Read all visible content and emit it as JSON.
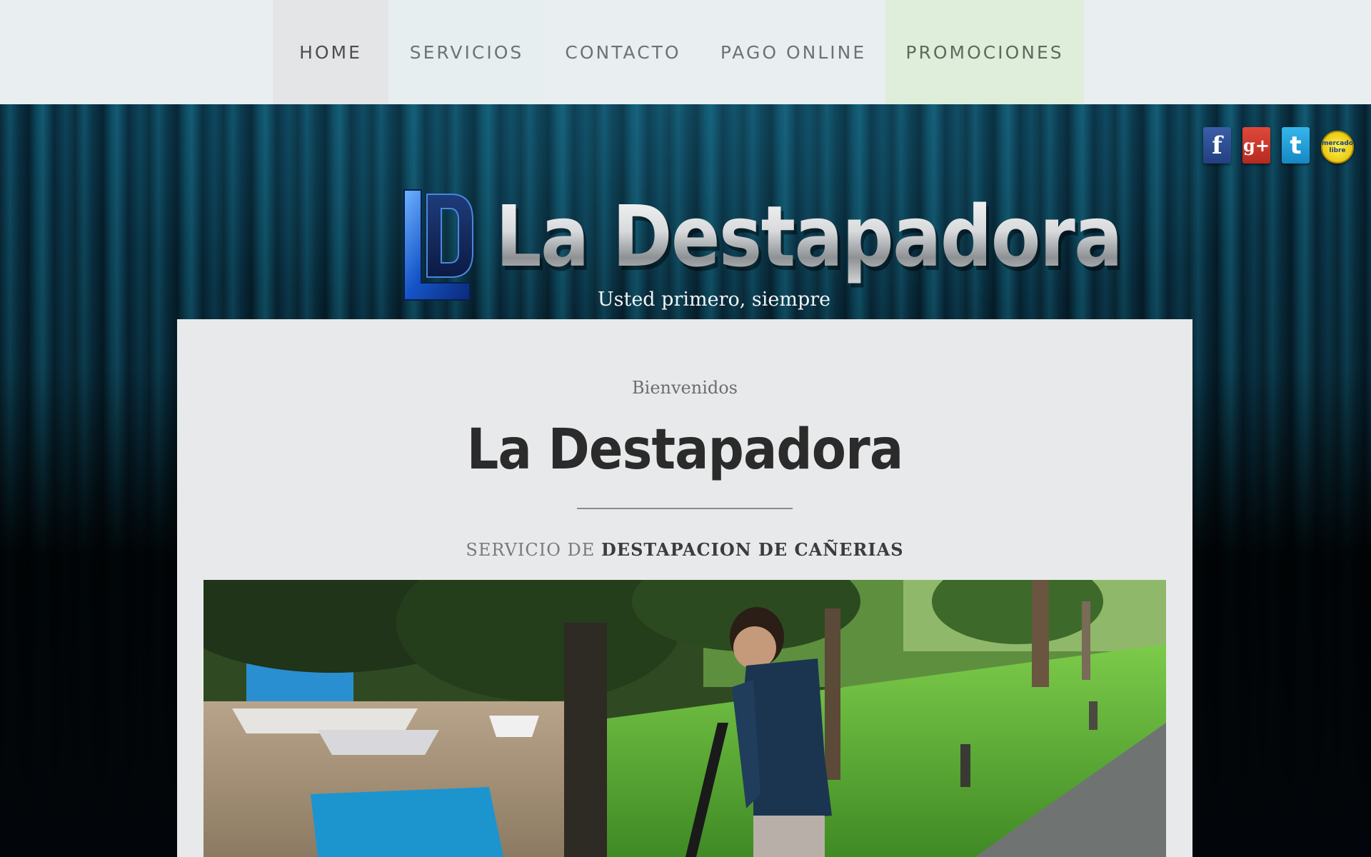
{
  "nav": {
    "items": [
      {
        "label": "HOME"
      },
      {
        "label": "SERVICIOS"
      },
      {
        "label": "CONTACTO"
      },
      {
        "label": "PAGO ONLINE"
      },
      {
        "label": "PROMOCIONES"
      }
    ]
  },
  "social": {
    "facebook_glyph": "f",
    "googleplus_glyph": "g+",
    "twitter_glyph": "t",
    "mercadolibre_label": "mercado libre"
  },
  "header": {
    "logo_mark": "LD",
    "brand": "La Destapadora",
    "tagline": "Usted primero, siempre"
  },
  "content": {
    "welcome": "Bienvenidos",
    "title": "La Destapadora",
    "subtitle_prefix": "SERVICIO DE",
    "subtitle_strong": "DESTAPACION DE CAÑERIAS"
  },
  "colors": {
    "nav_background": "#e9eef0",
    "nav_active": "#e4e5e6",
    "nav_promo": "#dfeedb",
    "banner_teal": "#0f4f66",
    "panel_background": "#e8e9ea",
    "title_color": "#2b2b2b"
  }
}
